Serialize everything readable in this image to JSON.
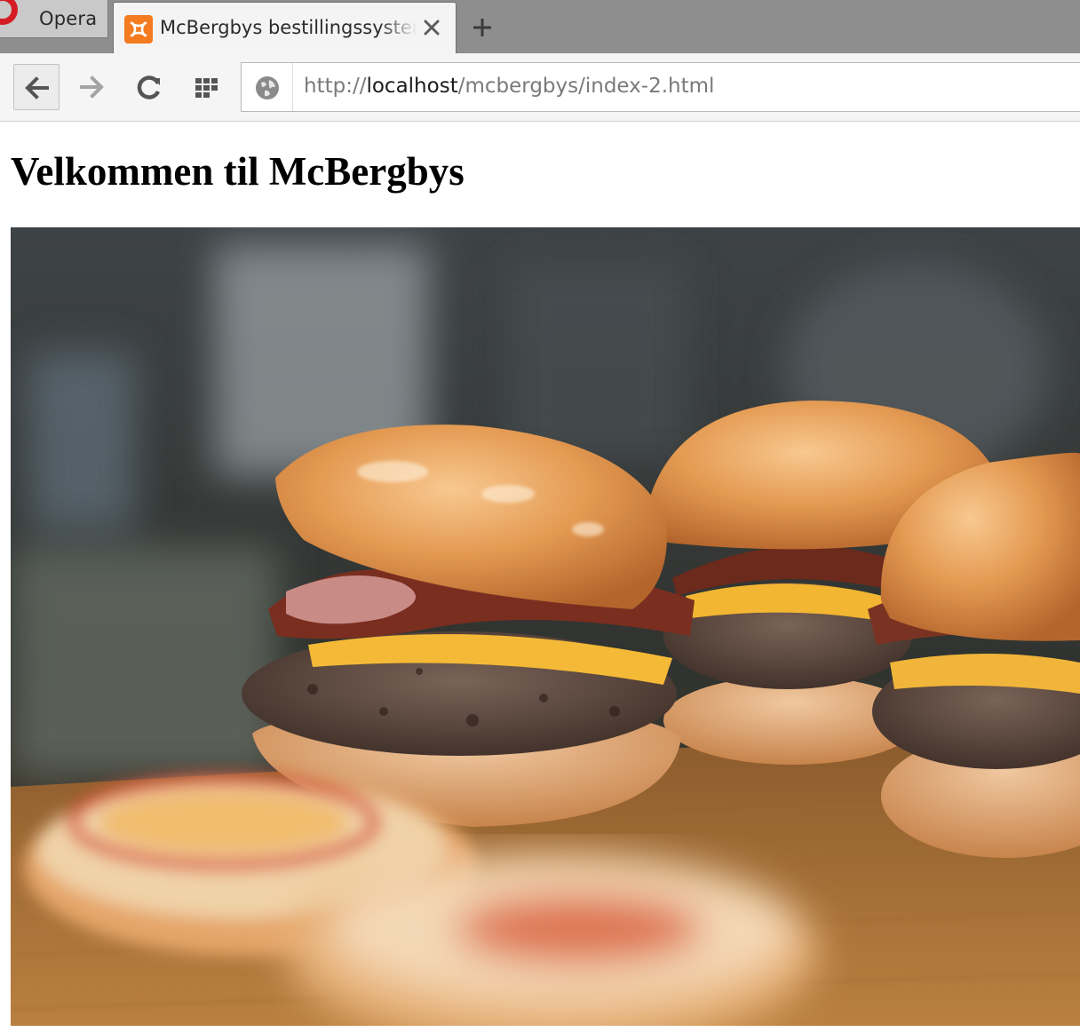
{
  "browser": {
    "menu_label": "Opera",
    "active_tab": {
      "title": "McBergbys bestillingssystem",
      "favicon": "xampp-icon"
    },
    "address": {
      "scheme": "http://",
      "host": "localhost",
      "path": "/mcbergbys/index-2.html"
    },
    "accent_color": "#d51c24"
  },
  "page": {
    "heading": "Velkommen til McBergbys",
    "hero_image": "burger-photo"
  }
}
